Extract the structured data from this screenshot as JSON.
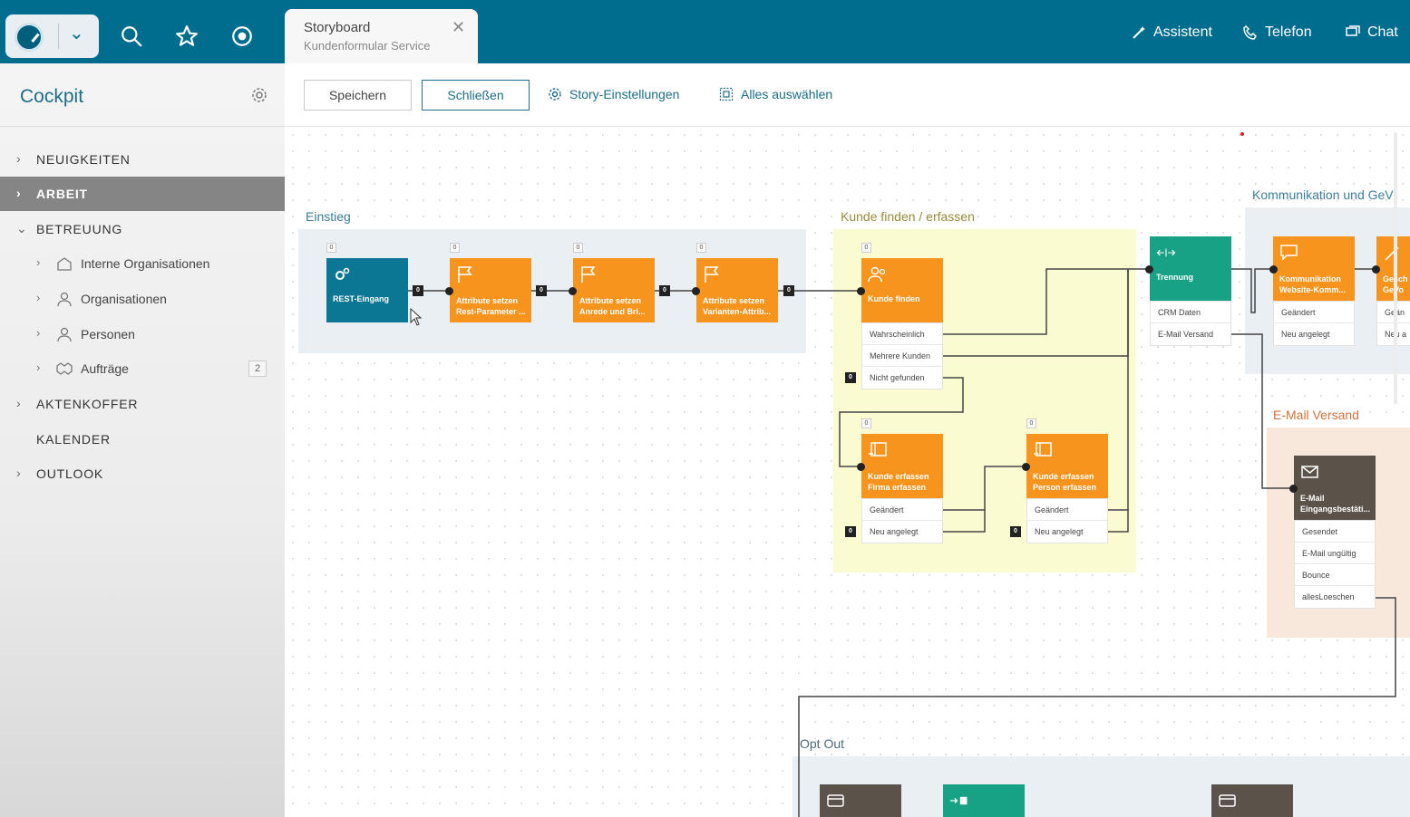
{
  "tab": {
    "title": "Storyboard",
    "subtitle": "Kundenformular Service"
  },
  "top_actions": {
    "assistant": "Assistent",
    "phone": "Telefon",
    "chat": "Chat"
  },
  "sidebar": {
    "title": "Cockpit",
    "items": [
      {
        "label": "NEUIGKEITEN"
      },
      {
        "label": "ARBEIT"
      },
      {
        "label": "BETREUUNG"
      },
      {
        "label": "AKTENKOFFER"
      },
      {
        "label": "KALENDER"
      },
      {
        "label": "OUTLOOK"
      }
    ],
    "sub_items": [
      {
        "label": "Interne Organisationen"
      },
      {
        "label": "Organisationen"
      },
      {
        "label": "Personen"
      },
      {
        "label": "Aufträge",
        "badge": "2"
      }
    ]
  },
  "toolbar": {
    "save": "Speichern",
    "close": "Schließen",
    "settings": "Story-Einstellungen",
    "select_all": "Alles auswählen"
  },
  "regions": {
    "einstieg": "Einstieg",
    "kunde": "Kunde finden / erfassen",
    "kommunikation": "Kommunikation und GeV",
    "email": "E-Mail Versand",
    "optout": "Opt Out"
  },
  "nodes": {
    "rest": {
      "label": "REST-Eingang",
      "count": "0"
    },
    "attr1": {
      "label": "Attribute setzen\nRest-Parameter ...",
      "count": "0"
    },
    "attr2": {
      "label": "Attribute setzen\nAnrede und Bri...",
      "count": "0"
    },
    "attr3": {
      "label": "Attribute setzen\nVarianten-Attrib...",
      "count": "0"
    },
    "kunde_finden": {
      "label": "Kunde finden",
      "count": "0",
      "options": [
        "Wahrscheinlich",
        "Mehrere Kunden",
        "Nicht gefunden"
      ]
    },
    "kunde_firma": {
      "label": "Kunde erfassen\nFirma erfassen",
      "count": "0",
      "options": [
        "Geändert",
        "Neu angelegt"
      ]
    },
    "kunde_person": {
      "label": "Kunde erfassen\nPerson erfassen",
      "count": "0",
      "options": [
        "Geändert",
        "Neu angelegt"
      ]
    },
    "trennung": {
      "label": "Trennung",
      "options": [
        "CRM Daten",
        "E-Mail Versand"
      ]
    },
    "komm": {
      "label": "Kommunikation\nWebsite-Komm...",
      "options": [
        "Geändert",
        "Neu angelegt"
      ]
    },
    "gesch": {
      "label": "Gesch\nGeVo",
      "options": [
        "Geän",
        "Neu a"
      ]
    },
    "email": {
      "label": "E-Mail\nEingangsbestäti...",
      "options": [
        "Gesendet",
        "E-Mail ungültig",
        "Bounce",
        "allesLoeschen"
      ]
    }
  },
  "connector_count": "0",
  "colors": {
    "header": "#006d8f",
    "orange": "#f7941d",
    "teal": "#17a185",
    "dark_blue": "#0b7794",
    "brown": "#5b524a"
  }
}
